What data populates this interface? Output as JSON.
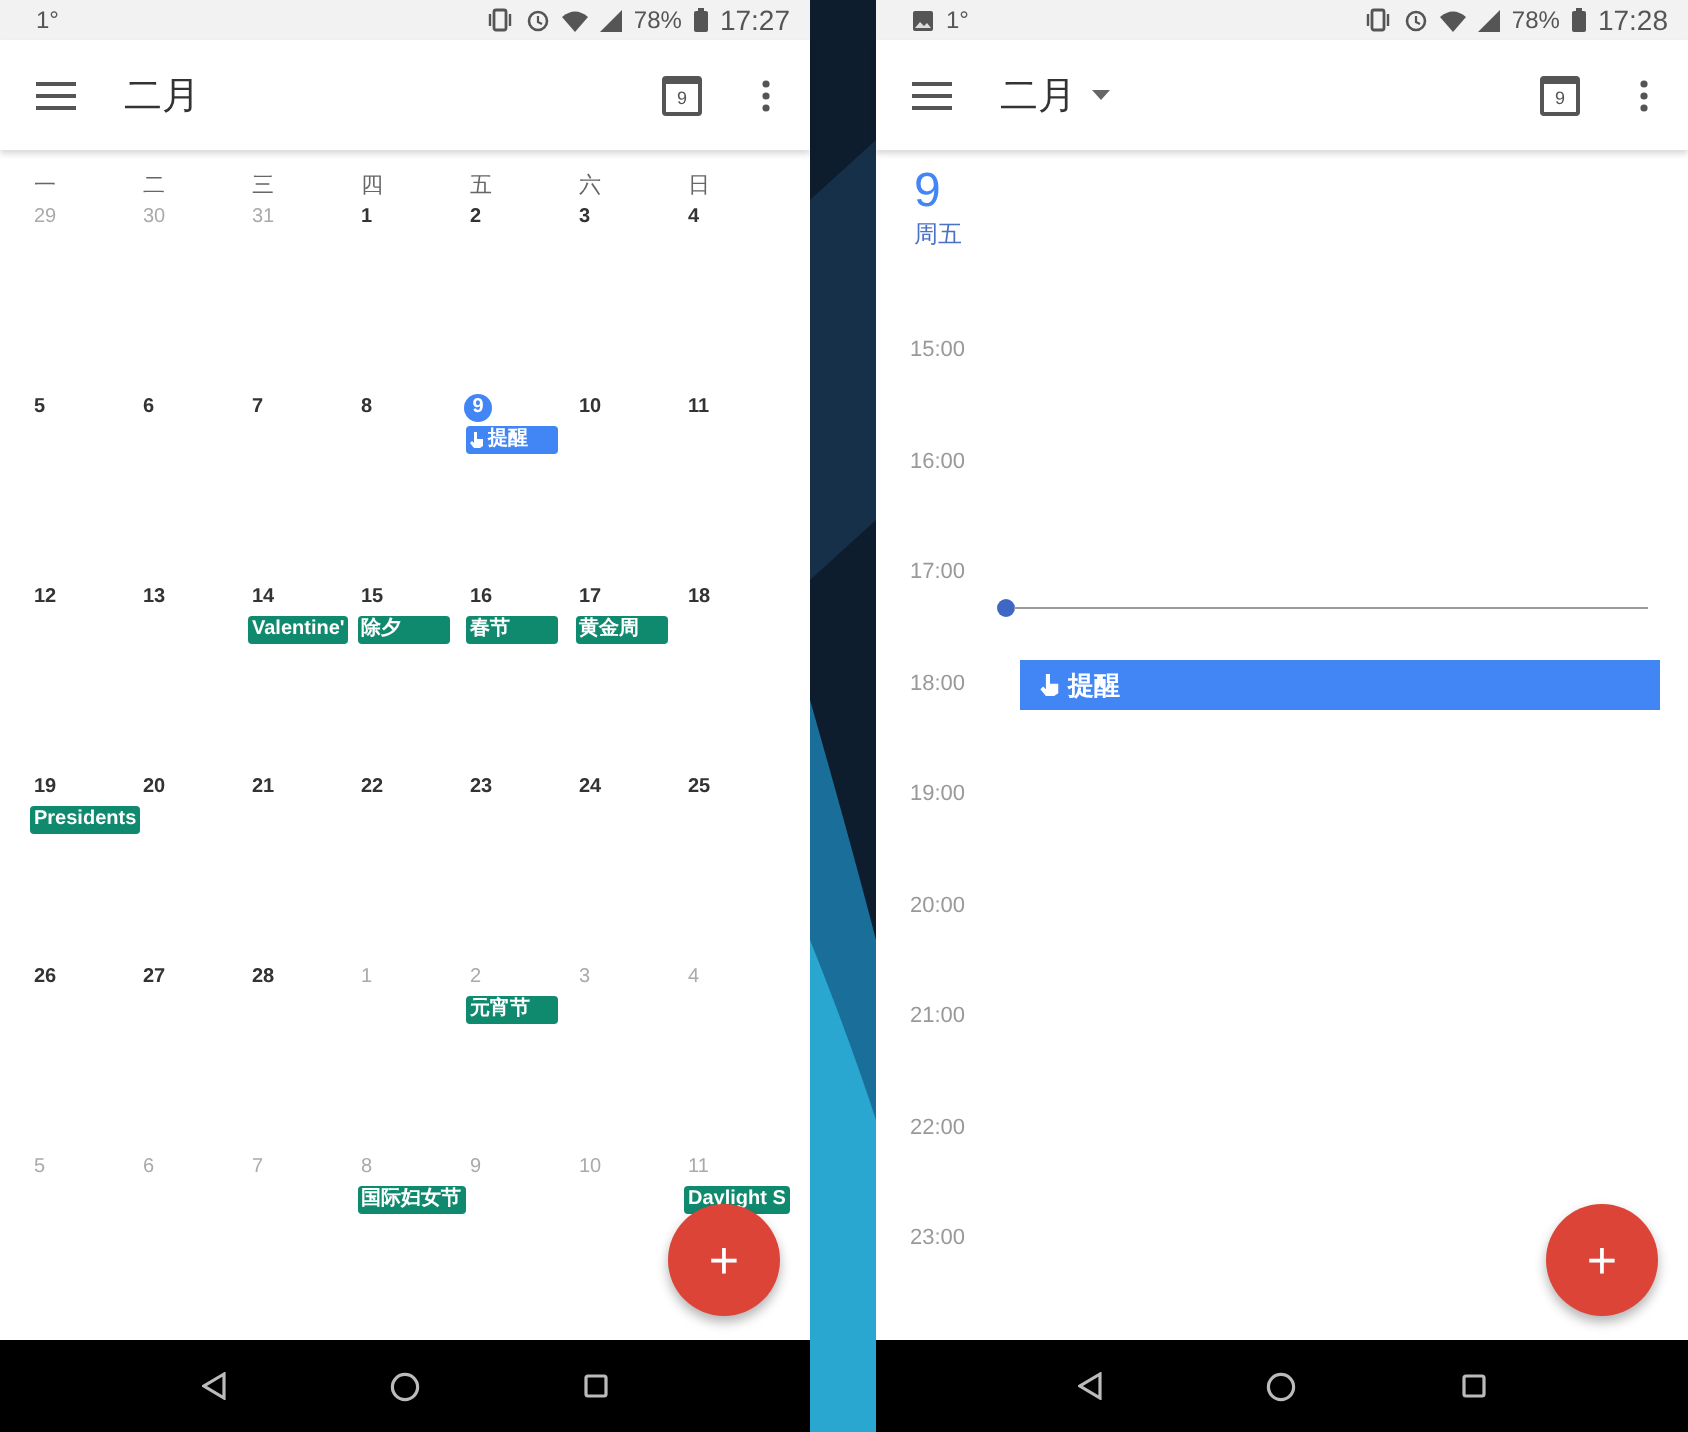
{
  "screens": [
    {
      "kind": "month",
      "status_bar": {
        "image_icon": false,
        "notification": "1°",
        "battery": "78%",
        "time": "17:27"
      },
      "header": {
        "title": "二月",
        "dropdown": false,
        "today_icon": "9"
      },
      "weekdays": [
        "一",
        "二",
        "三",
        "四",
        "五",
        "六",
        "日"
      ],
      "weeks": [
        [
          {
            "date": "29",
            "other_month": true,
            "today": false
          },
          {
            "date": "30",
            "other_month": true,
            "today": false
          },
          {
            "date": "31",
            "other_month": true,
            "today": false
          },
          {
            "date": "1",
            "other_month": false,
            "today": false
          },
          {
            "date": "2",
            "other_month": false,
            "today": false
          },
          {
            "date": "3",
            "other_month": false,
            "today": false
          },
          {
            "date": "4",
            "other_month": false,
            "today": false
          }
        ],
        [
          {
            "date": "5",
            "other_month": false,
            "today": false
          },
          {
            "date": "6",
            "other_month": false,
            "today": false
          },
          {
            "date": "7",
            "other_month": false,
            "today": false
          },
          {
            "date": "8",
            "other_month": false,
            "today": false
          },
          {
            "date": "9",
            "other_month": false,
            "today": true,
            "events": [
              {
                "title": "提醒",
                "kind": "reminder",
                "color": "#4285f4"
              }
            ]
          },
          {
            "date": "10",
            "other_month": false,
            "today": false
          },
          {
            "date": "11",
            "other_month": false,
            "today": false
          }
        ],
        [
          {
            "date": "12",
            "other_month": false,
            "today": false
          },
          {
            "date": "13",
            "other_month": false,
            "today": false
          },
          {
            "date": "14",
            "other_month": false,
            "today": false,
            "events": [
              {
                "title": "Valentine'",
                "kind": "holiday",
                "color": "#0f8a6e"
              }
            ]
          },
          {
            "date": "15",
            "other_month": false,
            "today": false,
            "events": [
              {
                "title": "除夕",
                "kind": "holiday",
                "color": "#0f8a6e"
              }
            ]
          },
          {
            "date": "16",
            "other_month": false,
            "today": false,
            "events": [
              {
                "title": "春节",
                "kind": "holiday",
                "color": "#0f8a6e"
              }
            ]
          },
          {
            "date": "17",
            "other_month": false,
            "today": false,
            "events": [
              {
                "title": "黄金周",
                "kind": "holiday",
                "color": "#0f8a6e"
              }
            ]
          },
          {
            "date": "18",
            "other_month": false,
            "today": false
          }
        ],
        [
          {
            "date": "19",
            "other_month": false,
            "today": false,
            "events": [
              {
                "title": "Presidents",
                "kind": "holiday",
                "color": "#0f8a6e"
              }
            ]
          },
          {
            "date": "20",
            "other_month": false,
            "today": false
          },
          {
            "date": "21",
            "other_month": false,
            "today": false
          },
          {
            "date": "22",
            "other_month": false,
            "today": false
          },
          {
            "date": "23",
            "other_month": false,
            "today": false
          },
          {
            "date": "24",
            "other_month": false,
            "today": false
          },
          {
            "date": "25",
            "other_month": false,
            "today": false
          }
        ],
        [
          {
            "date": "26",
            "other_month": false,
            "today": false
          },
          {
            "date": "27",
            "other_month": false,
            "today": false
          },
          {
            "date": "28",
            "other_month": false,
            "today": false
          },
          {
            "date": "1",
            "other_month": true,
            "today": false
          },
          {
            "date": "2",
            "other_month": true,
            "today": false,
            "events": [
              {
                "title": "元宵节",
                "kind": "holiday",
                "color": "#0f8a6e"
              }
            ]
          },
          {
            "date": "3",
            "other_month": true,
            "today": false
          },
          {
            "date": "4",
            "other_month": true,
            "today": false
          }
        ],
        [
          {
            "date": "5",
            "other_month": true,
            "today": false
          },
          {
            "date": "6",
            "other_month": true,
            "today": false
          },
          {
            "date": "7",
            "other_month": true,
            "today": false
          },
          {
            "date": "8",
            "other_month": true,
            "today": false,
            "events": [
              {
                "title": "国际妇女节",
                "kind": "holiday",
                "color": "#0f8a6e"
              }
            ]
          },
          {
            "date": "9",
            "other_month": true,
            "today": false
          },
          {
            "date": "10",
            "other_month": true,
            "today": false
          },
          {
            "date": "11",
            "other_month": true,
            "today": false,
            "events": [
              {
                "title": "Daylight S",
                "kind": "holiday",
                "color": "#0f8a6e"
              }
            ]
          }
        ]
      ],
      "fab": "+"
    },
    {
      "kind": "day",
      "status_bar": {
        "image_icon": true,
        "notification": "1°",
        "battery": "78%",
        "time": "17:28"
      },
      "header": {
        "title": "二月",
        "dropdown": true,
        "today_icon": "9"
      },
      "day": {
        "number": "9",
        "weekday": "周五"
      },
      "hours": [
        "15:00",
        "16:00",
        "17:00",
        "18:00",
        "19:00",
        "20:00",
        "21:00",
        "22:00",
        "23:00"
      ],
      "event": {
        "title": "提醒",
        "kind": "reminder"
      },
      "fab": "+"
    }
  ]
}
